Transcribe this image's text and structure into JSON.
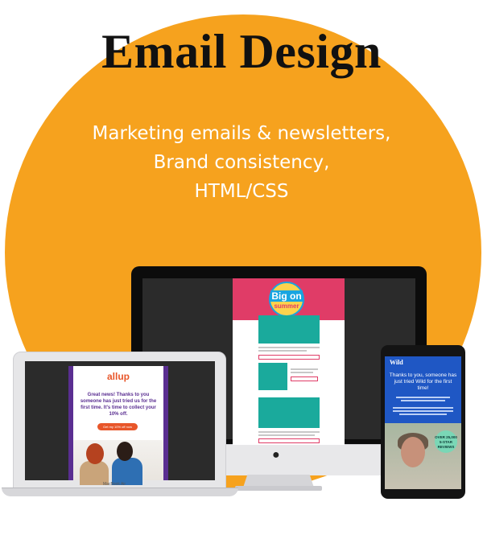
{
  "headline": "Email Design",
  "subtitle": {
    "line1": "Marketing emails & newsletters,",
    "line2": "Brand consistency,",
    "line3": "HTML/CSS"
  },
  "colors": {
    "circle": "#f6a21e",
    "monitor_email_header": "#e03c67",
    "monitor_email_accent": "#1aaa9c",
    "laptop_email_border": "#5a2e91",
    "laptop_email_accent": "#e8562a",
    "tablet_email_bg": "#1f57c4"
  },
  "monitor_email": {
    "badge_top": "Big on",
    "badge_bottom": "summer"
  },
  "laptop": {
    "label": "MacBook Air",
    "email": {
      "logo": "allup",
      "message": "Great news! Thanks to you someone has just tried us for the first time. It's time to collect your 10% off.",
      "cta": "Get my 10% off now"
    }
  },
  "tablet": {
    "email": {
      "brand": "Wild",
      "message": "Thanks to you, someone has just tried Wild for the first time!",
      "sticker": "OVER 25,000 5-STAR REVIEWS"
    }
  },
  "icons": [
    "apple-logo-icon"
  ]
}
